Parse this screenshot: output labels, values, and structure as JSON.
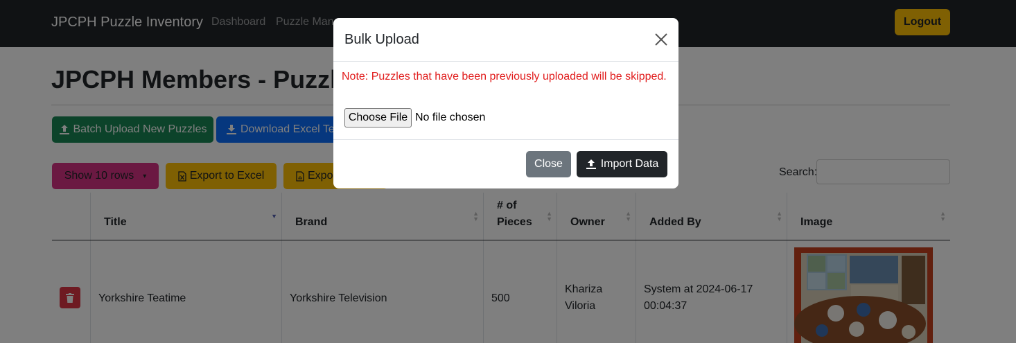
{
  "navbar": {
    "brand": "JPCPH Puzzle Inventory",
    "links": [
      "Dashboard",
      "Puzzle Mana"
    ],
    "logout_label": "Logout"
  },
  "page": {
    "title": "JPCPH Members - Puzzle",
    "batch_upload_label": "Batch Upload New Puzzles",
    "download_label": "Download Excel Te",
    "show_rows_label": "Show 10 rows",
    "export_excel_label": "Export to Excel",
    "export_pdf_label": "Expo",
    "search_label": "Search:"
  },
  "table": {
    "headers": [
      "Title",
      "Brand",
      "# of Pieces",
      "Owner",
      "Added By",
      "Image"
    ],
    "rows": [
      {
        "title": "Yorkshire Teatime",
        "brand": "Yorkshire Television",
        "pieces": "500",
        "owner": "Khariza Viloria",
        "added_by": "System at 2024-06-17 00:04:37"
      }
    ]
  },
  "modal": {
    "title": "Bulk Upload",
    "note": "Note: Puzzles that have been previously uploaded will be skipped.",
    "choose_file_label": "Choose File",
    "file_status": "No file chosen",
    "close_label": "Close",
    "import_label": "Import Data"
  },
  "colors": {
    "navbar": "#212529",
    "success": "#198754",
    "primary": "#0d6efd",
    "warning": "#ffc107",
    "pink": "#d63384",
    "danger": "#dc3545",
    "secondary": "#6c757d",
    "note_red": "#e11d1d"
  },
  "icons": [
    "upload-icon",
    "download-icon",
    "file-excel-icon",
    "file-pdf-icon",
    "trash-icon",
    "close-icon",
    "sort-icon"
  ]
}
